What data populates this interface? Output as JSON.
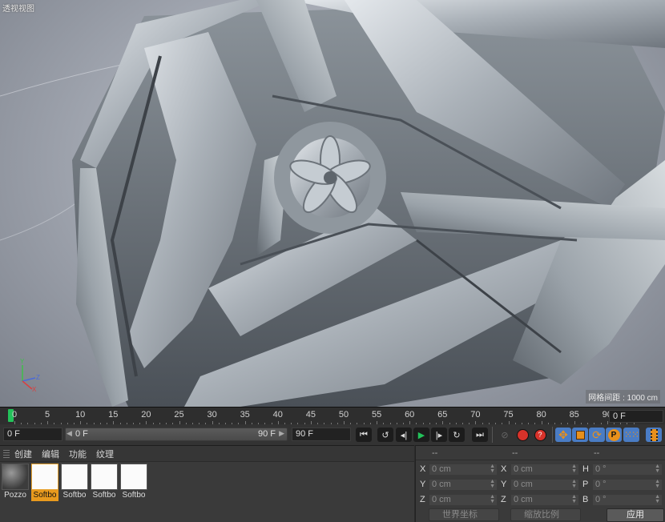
{
  "viewport": {
    "title": "透视视图",
    "grid_spacing": "网格间距 : 1000 cm",
    "axes": {
      "y": "Y",
      "z": "Z",
      "x": "X"
    }
  },
  "timeline": {
    "ticks": [
      "0",
      "5",
      "10",
      "15",
      "20",
      "25",
      "30",
      "35",
      "40",
      "45",
      "50",
      "55",
      "60",
      "65",
      "70",
      "75",
      "80",
      "85",
      "90"
    ],
    "current_frame_field": "0 F"
  },
  "transport": {
    "start_field": "0 F",
    "range_start": "0 F",
    "range_end": "90 F",
    "end_field": "90 F",
    "buttons": [
      "go-start-icon",
      "prev-key-icon",
      "prev-frame-icon",
      "play-icon",
      "next-frame-icon",
      "next-key-icon",
      "go-end-icon",
      "record-off-icon",
      "record-icon",
      "autokey-icon",
      "move-icon",
      "scale-icon",
      "rotate-icon",
      "param-icon",
      "grid-points-icon",
      "film-icon"
    ],
    "colors": {
      "play": "#23c25a",
      "record": "#d8322a",
      "accent": "#e8901c",
      "active_bg": "#4a7cc4"
    }
  },
  "material_manager": {
    "menu": [
      "创建",
      "编辑",
      "功能",
      "纹理"
    ],
    "materials": [
      {
        "name": "Pozzo",
        "selected": false
      },
      {
        "name": "Softbo",
        "selected": true
      },
      {
        "name": "Softbo",
        "selected": false
      },
      {
        "name": "Softbo",
        "selected": false
      },
      {
        "name": "Softbo",
        "selected": false
      }
    ]
  },
  "coordinates": {
    "headers": [
      "--",
      "--",
      "--"
    ],
    "rows": [
      {
        "a_label": "X",
        "a_val": "0 cm",
        "b_label": "X",
        "b_val": "0 cm",
        "c_label": "H",
        "c_val": "0 °"
      },
      {
        "a_label": "Y",
        "a_val": "0 cm",
        "b_label": "Y",
        "b_val": "0 cm",
        "c_label": "P",
        "c_val": "0 °"
      },
      {
        "a_label": "Z",
        "a_val": "0 cm",
        "b_label": "Z",
        "b_val": "0 cm",
        "c_label": "B",
        "c_val": "0 °"
      }
    ],
    "world_dropdown": "世界坐标",
    "scale_dropdown": "缩放比例",
    "apply_label": "应用"
  }
}
